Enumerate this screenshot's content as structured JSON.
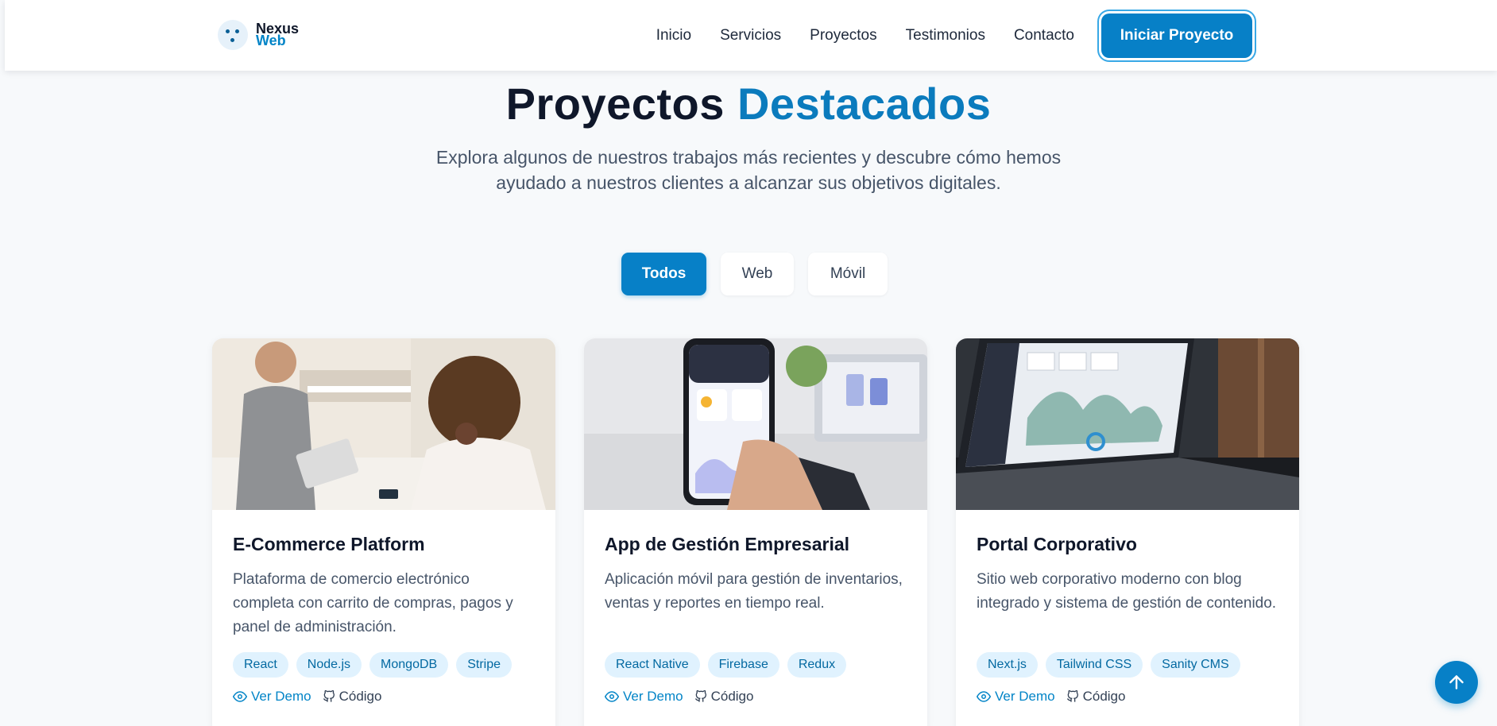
{
  "brand": {
    "line1": "Nexus",
    "line2": "Web"
  },
  "nav": {
    "links": [
      "Inicio",
      "Servicios",
      "Proyectos",
      "Testimonios",
      "Contacto"
    ],
    "cta": "Iniciar Proyecto"
  },
  "hero": {
    "title_main": "Proyectos",
    "title_accent": "Destacados",
    "subtitle_line1": "Explora algunos de nuestros trabajos más recientes y descubre cómo hemos",
    "subtitle_line2": "ayudado a nuestros clientes a alcanzar sus objetivos digitales."
  },
  "filters": [
    "Todos",
    "Web",
    "Móvil"
  ],
  "projects": [
    {
      "title": "E-Commerce Platform",
      "description": "Plataforma de comercio electrónico completa con carrito de compras, pagos y panel de administración.",
      "tags": [
        "React",
        "Node.js",
        "MongoDB",
        "Stripe"
      ],
      "demo": "Ver Demo",
      "code": "Código"
    },
    {
      "title": "App de Gestión Empresarial",
      "description": "Aplicación móvil para gestión de inventarios, ventas y reportes en tiempo real.",
      "tags": [
        "React Native",
        "Firebase",
        "Redux"
      ],
      "demo": "Ver Demo",
      "code": "Código"
    },
    {
      "title": "Portal Corporativo",
      "description": "Sitio web corporativo moderno con blog integrado y sistema de gestión de contenido.",
      "tags": [
        "Next.js",
        "Tailwind CSS",
        "Sanity CMS"
      ],
      "demo": "Ver Demo",
      "code": "Código"
    }
  ],
  "colors": {
    "primary": "#0780c7",
    "accent_text": "#0b7bbd",
    "tag_bg": "#e0f2fe",
    "tag_text": "#0369a1"
  },
  "icons": {
    "demo": "eye-icon",
    "code": "github-icon",
    "scroll_top": "arrow-up-icon"
  }
}
